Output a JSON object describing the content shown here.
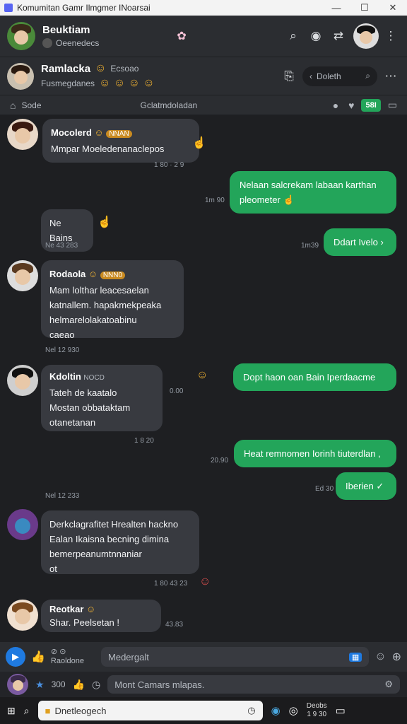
{
  "window": {
    "title": "Komumitan Gamr Ilmgmer INoarsai",
    "minimize": "—",
    "maximize": "☐",
    "close": "✕"
  },
  "header1": {
    "name": "Beuktiam",
    "sub": "Oeenedecs"
  },
  "header2": {
    "name": "Ramlacka",
    "status": "Ecsoao",
    "sub": "Fusmegdanes",
    "search_label": "Doleth"
  },
  "toolbar": {
    "left": "Sode",
    "center": "Gclatmdoladan",
    "badge": "58I"
  },
  "messages": {
    "m1": {
      "sender": "Mocolerd",
      "tag": "NNAN",
      "text": "Mmpar Moeledenanaclepos",
      "time": "1 80 · 2 9"
    },
    "o1": {
      "text": "Nelaan salcrekam labaan karthan pleometer",
      "time": "1m 90"
    },
    "m2": {
      "text": "Ne Bains",
      "time": "Ne 43 283"
    },
    "o2": {
      "text": "Ddart Ivelo",
      "time": "1m39"
    },
    "m3": {
      "sender": "Rodaola",
      "tag": "NNN0",
      "line1": "Mam lolthar leacesaelan",
      "line2": "katnallem. hapakmekpeaka",
      "line3": "helmarelolakatoabinu",
      "line4": "caeao",
      "time": "Nel 12 930"
    },
    "m4": {
      "sender": "Kdoltin",
      "tag": "NOCD",
      "line1": "Tateh de kaatalo",
      "line2": "Mostan obbataktam",
      "line3": "otanetanan",
      "side": "0.00",
      "time": "1 8 20"
    },
    "o3": {
      "text": "Dopt haon oan Bain Iperdaacme"
    },
    "o4": {
      "text": "Heat remnomen Iorinh tiuterdlan ,",
      "time": "20.90"
    },
    "o5": {
      "text": "Iberien",
      "time": "Ed 30"
    },
    "m5": {
      "line1": "Derkclagrafitet Hrealten hackno",
      "line2": "Ealan Ikaisna becning dimina",
      "line3": "bemerpeanumtnnaniar",
      "line4": "ot",
      "time": "Nel 12 233",
      "time2": "1 80 43 23"
    },
    "m6": {
      "sender": "Reotkar",
      "text": "Shar. Peelsetan !",
      "time": "43.83"
    }
  },
  "composer": {
    "label": "Raoldone",
    "placeholder": "Medergalt"
  },
  "composer2": {
    "count": "300",
    "placeholder": "Mont Camars mlapas."
  },
  "taskbar": {
    "search": "Dnetleogech",
    "clock1": "Deobs",
    "clock2": "1 9 30"
  }
}
